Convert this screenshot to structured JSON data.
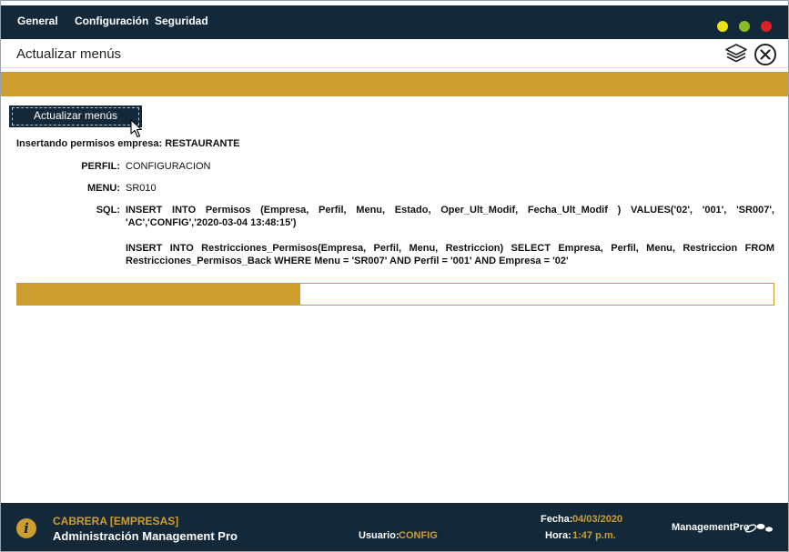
{
  "menubar": {
    "items": [
      "General",
      "Configuración",
      "Seguridad"
    ],
    "window_dots": [
      {
        "name": "minimize",
        "color": "#e8e21b"
      },
      {
        "name": "maximize",
        "color": "#8dbb25"
      },
      {
        "name": "close",
        "color": "#d6232a"
      }
    ]
  },
  "titlebar": {
    "title": "Actualizar menús",
    "icons": [
      "layers-icon",
      "close-circle-icon"
    ]
  },
  "action": {
    "button_label": "Actualizar menús"
  },
  "status": {
    "line": "Insertando permisos empresa: RESTAURANTE",
    "perfil_label": "PERFIL:",
    "perfil_value": "CONFIGURACION",
    "menu_label": "MENU:",
    "menu_value": "SR010",
    "sql_label": "SQL:",
    "sql_statements": [
      "INSERT INTO Permisos (Empresa, Perfil, Menu, Estado, Oper_Ult_Modif, Fecha_Ult_Modif ) VALUES('02', '001', 'SR007', 'AC','CONFIG','2020-03-04 13:48:15')",
      "INSERT INTO Restricciones_Permisos(Empresa, Perfil, Menu, Restriccion) SELECT Empresa, Perfil, Menu, Restriccion FROM Restricciones_Permisos_Back WHERE Menu = 'SR007' AND Perfil = '001' AND Empresa = '02'"
    ]
  },
  "progress": {
    "fraction": 0.374
  },
  "footer": {
    "company": "CABRERA [EMPRESAS]",
    "app_name": "Administración Management Pro",
    "user_label": "Usuario:",
    "user_value": "CONFIG",
    "date_label": "Fecha:",
    "date_value": "04/03/2020",
    "time_label": "Hora:",
    "time_value": "1:47 p.m.",
    "brand_text": "ManagementPro"
  },
  "colors": {
    "navy": "#13293a",
    "gold": "#cd9d30"
  }
}
